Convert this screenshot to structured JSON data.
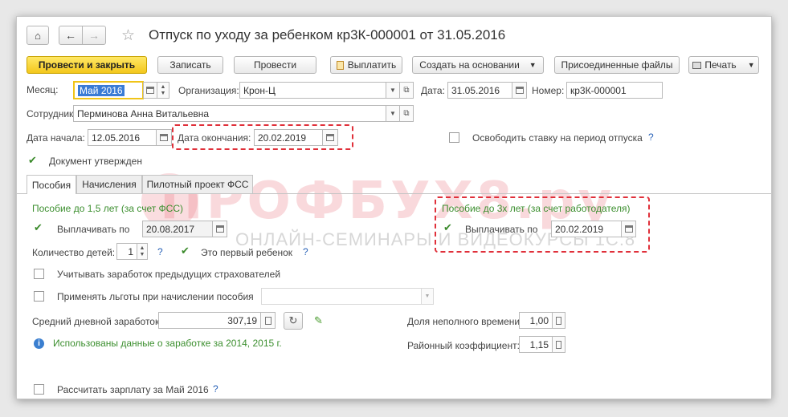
{
  "header": {
    "title": "Отпуск по уходу за ребенком кр3К-000001 от 31.05.2016"
  },
  "toolbar": {
    "post_close": "Провести и закрыть",
    "save": "Записать",
    "post": "Провести",
    "pay": "Выплатить",
    "create_based": "Создать на основании",
    "attached_files": "Присоединенные файлы",
    "print": "Печать"
  },
  "form": {
    "month_label": "Месяц:",
    "month_value": "Май 2016",
    "org_label": "Организация:",
    "org_value": "Крон-Ц",
    "date_label": "Дата:",
    "date_value": "31.05.2016",
    "number_label": "Номер:",
    "number_value": "кр3К-000001",
    "employee_label": "Сотрудник:",
    "employee_value": "Перминова Анна Витальевна",
    "start_label": "Дата начала:",
    "start_value": "12.05.2016",
    "end_label": "Дата окончания:",
    "end_value": "20.02.2019",
    "free_rate_label": "Освободить ставку на период отпуска",
    "help": "?",
    "approved_label": "Документ утвержден"
  },
  "tabs": [
    "Пособия",
    "Начисления",
    "Пилотный проект ФСС"
  ],
  "benefits": {
    "section15": "Пособие до 1,5 лет (за счет ФСС)",
    "pay_until_label": "Выплачивать по",
    "pay_until_value": "20.08.2017",
    "children_label": "Количество детей:",
    "children_value": "1",
    "first_child_label": "Это первый ребенок",
    "prev_insurers_label": "Учитывать заработок предыдущих страхователей",
    "benefits_label": "Применять льготы при начислении пособия",
    "avg_daily_label": "Средний дневной заработок:",
    "avg_daily_value": "307,19",
    "info_text": "Использованы данные о заработке за  2014,  2015 г.",
    "section3": "Пособие до 3х лет (за счет работодателя)",
    "pay_until3_label": "Выплачивать по",
    "pay_until3_value": "20.02.2019",
    "part_time_label": "Доля неполного времени:",
    "part_time_value": "1,00",
    "regional_label": "Районный коэффициент:",
    "regional_value": "1,15",
    "calc_salary_label": "Рассчитать зарплату за Май 2016"
  },
  "watermark": {
    "brand": "ПРОФБУХ8.ру",
    "tagline": "ОНЛАЙН-СЕМИНАРЫ И ВИДЕОКУРСЫ 1С:8"
  }
}
